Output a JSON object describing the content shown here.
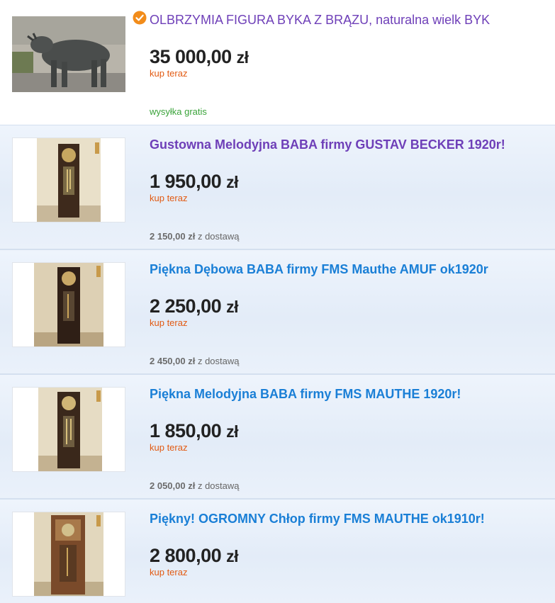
{
  "colors": {
    "title_purple": "#6e3fb8",
    "title_blue": "#1a7fd6",
    "price": "#222222",
    "buy_now": "#e25a12",
    "free_shipping": "#3aa33a",
    "verified_badge": "#f28c1a"
  },
  "listings": [
    {
      "title": "OLBRZYMIA FIGURA BYKA Z BRĄZU, naturalna wielk BYK",
      "price": "35 000,00",
      "currency": "zł",
      "buy_label": "kup teraz",
      "shipping": "wysyłka gratis",
      "badge_icon": "verified-check-icon",
      "image": "bronze-bull-statue"
    },
    {
      "title": "Gustowna Melodyjna BABA firmy GUSTAV BECKER 1920r!",
      "price": "1 950,00",
      "currency": "zł",
      "buy_label": "kup teraz",
      "shipping_price": "2 150,00 zł",
      "shipping_suffix": "z dostawą",
      "image": "grandfather-clock"
    },
    {
      "title": "Piękna Dębowa BABA firmy FMS Mauthe AMUF ok1920r",
      "price": "2 250,00",
      "currency": "zł",
      "buy_label": "kup teraz",
      "shipping_price": "2 450,00 zł",
      "shipping_suffix": "z dostawą",
      "image": "grandfather-clock"
    },
    {
      "title": "Piękna Melodyjna BABA firmy FMS MAUTHE 1920r!",
      "price": "1 850,00",
      "currency": "zł",
      "buy_label": "kup teraz",
      "shipping_price": "2 050,00 zł",
      "shipping_suffix": "z dostawą",
      "image": "grandfather-clock"
    },
    {
      "title": "Piękny! OGROMNY Chłop firmy FMS MAUTHE ok1910r!",
      "price": "2 800,00",
      "currency": "zł",
      "buy_label": "kup teraz",
      "image": "grandfather-clock"
    }
  ]
}
